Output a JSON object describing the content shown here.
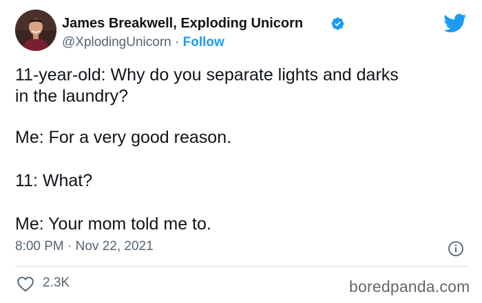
{
  "author": {
    "display_name": "James Breakwell, Exploding Unicorn",
    "handle": "@XplodingUnicorn",
    "separator": " · ",
    "follow_label": "Follow",
    "verified_color": "#1d9bf0"
  },
  "icons": {
    "verified": "verified-badge-icon",
    "brand": "twitter-bird-icon",
    "info": "info-icon",
    "like": "heart-icon"
  },
  "tweet": {
    "lines": [
      "11-year-old: Why do you separate lights and darks",
      "in the laundry?",
      "Me: For a very good reason.",
      "11: What?",
      "Me: Your mom told me to."
    ],
    "timestamp": "8:00 PM · Nov 22, 2021"
  },
  "stats": {
    "likes": "2.3K"
  },
  "watermark": "boredpanda.com",
  "colors": {
    "brand_blue": "#1d9bf0",
    "secondary_text": "#536471",
    "primary_text": "#0f1419"
  }
}
